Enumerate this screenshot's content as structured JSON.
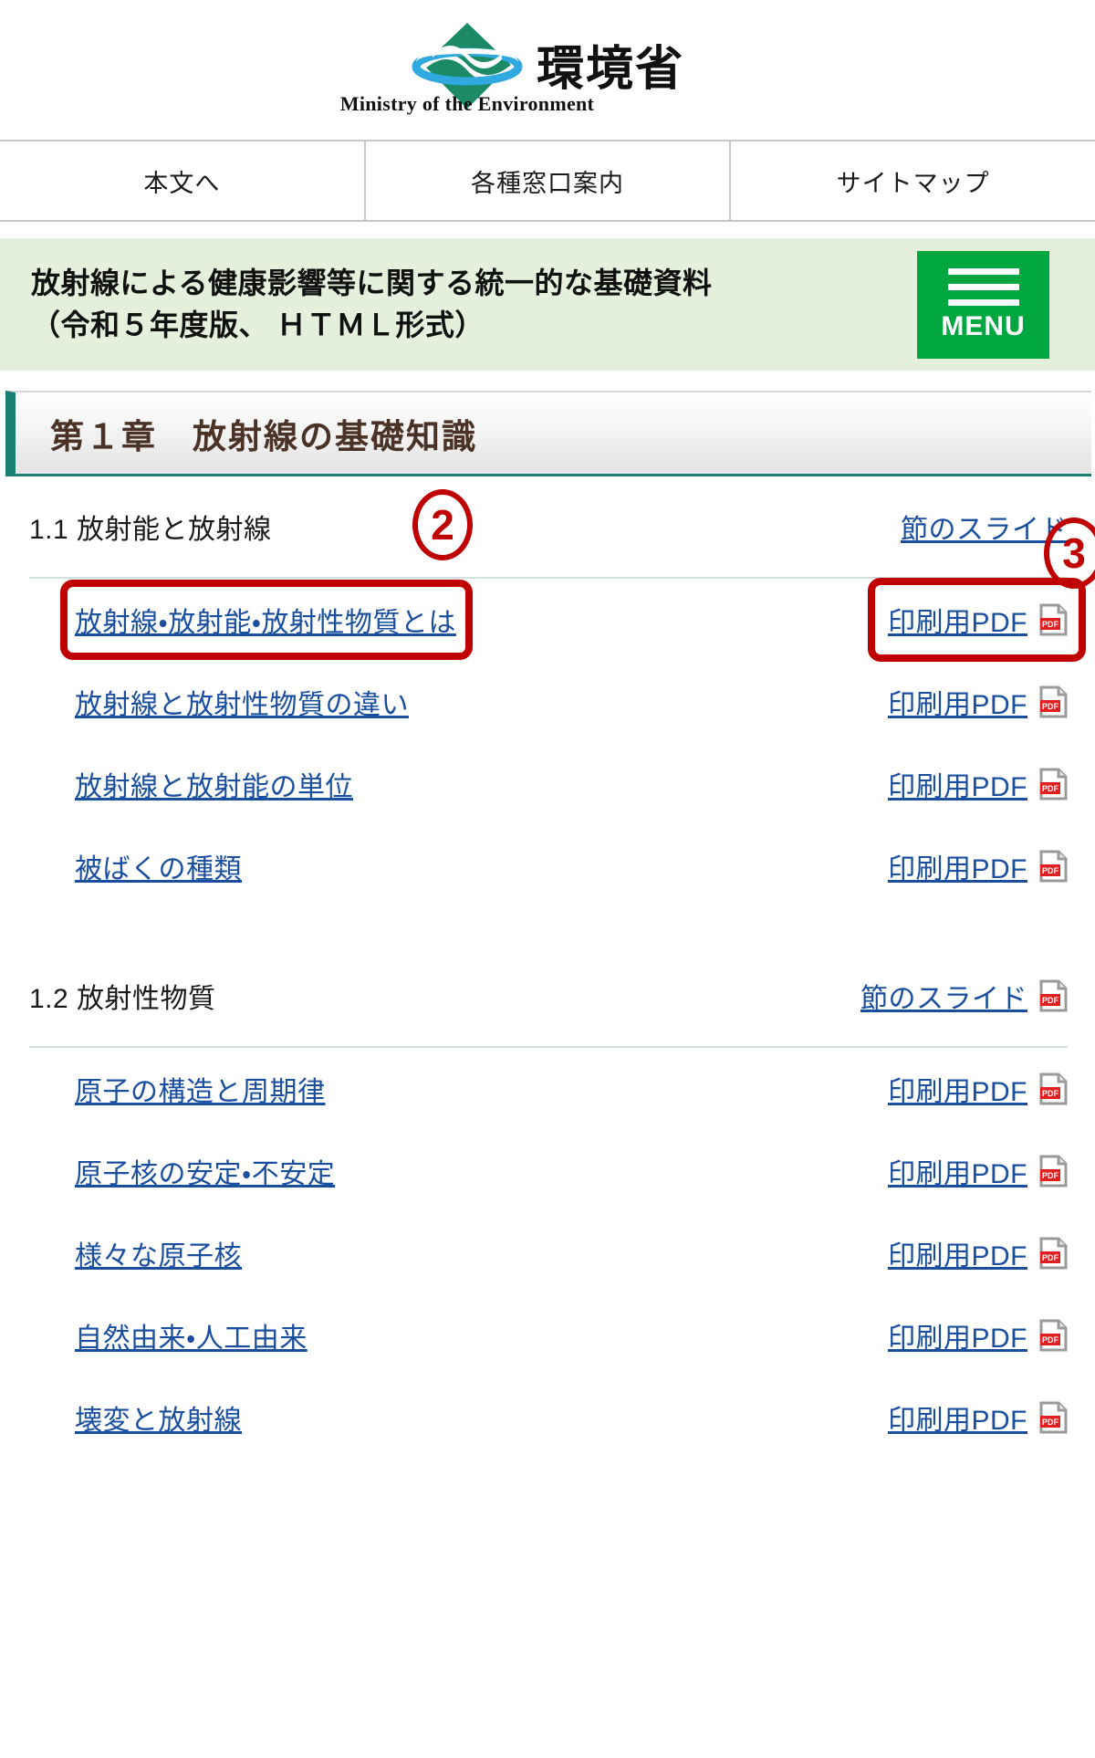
{
  "site": {
    "logo_jp": "環境省",
    "logo_en": "Ministry of the Environment",
    "logo_mark_name": "moe-diamond-globe-logo"
  },
  "topnav": {
    "items": [
      {
        "label": "本文へ"
      },
      {
        "label": "各種窓口案内"
      },
      {
        "label": "サイトマップ"
      }
    ]
  },
  "banner": {
    "title": "放射線による健康影響等に関する統一的な基礎資料\n（令和５年度版、 ＨＴＭＬ形式）",
    "menu_label": "MENU",
    "menu_color": "#00a63f",
    "background_color": "#e4efdc"
  },
  "chapter": {
    "title": "第１章　放射線の基礎知識",
    "title_color": "#4a3226",
    "accent_color": "#1a8074"
  },
  "annotations": {
    "circle_2": "②",
    "circle_2_text": "2",
    "circle_3": "③",
    "circle_3_text": "3",
    "highlight_color": "#c00000"
  },
  "labels": {
    "pdf_link": "印刷用PDF",
    "slide_link": "節のスライド",
    "pdf_icon_name": "pdf-file-icon",
    "pdf_icon_text": "PDF"
  },
  "sections": [
    {
      "number": "1.1",
      "title": "1.1 放射能と放射線",
      "slide_label": "節のスライド",
      "items": [
        {
          "title": "放射線・放射能・放射性物質とは",
          "pdf_label": "印刷用PDF",
          "highlighted": true
        },
        {
          "title": "放射線と放射性物質の違い",
          "pdf_label": "印刷用PDF",
          "highlighted": false
        },
        {
          "title": "放射線と放射能の単位",
          "pdf_label": "印刷用PDF",
          "highlighted": false
        },
        {
          "title": "被ばくの種類",
          "pdf_label": "印刷用PDF",
          "highlighted": false
        }
      ]
    },
    {
      "number": "1.2",
      "title": "1.2 放射性物質",
      "slide_label": "節のスライド",
      "items": [
        {
          "title": "原子の構造と周期律",
          "pdf_label": "印刷用PDF",
          "highlighted": false
        },
        {
          "title": "原子核の安定・不安定",
          "pdf_label": "印刷用PDF",
          "highlighted": false
        },
        {
          "title": "様々な原子核",
          "pdf_label": "印刷用PDF",
          "highlighted": false
        },
        {
          "title": "自然由来・人工由来",
          "pdf_label": "印刷用PDF",
          "highlighted": false
        },
        {
          "title": "壊変と放射線",
          "pdf_label": "印刷用PDF",
          "highlighted": false
        }
      ]
    }
  ]
}
